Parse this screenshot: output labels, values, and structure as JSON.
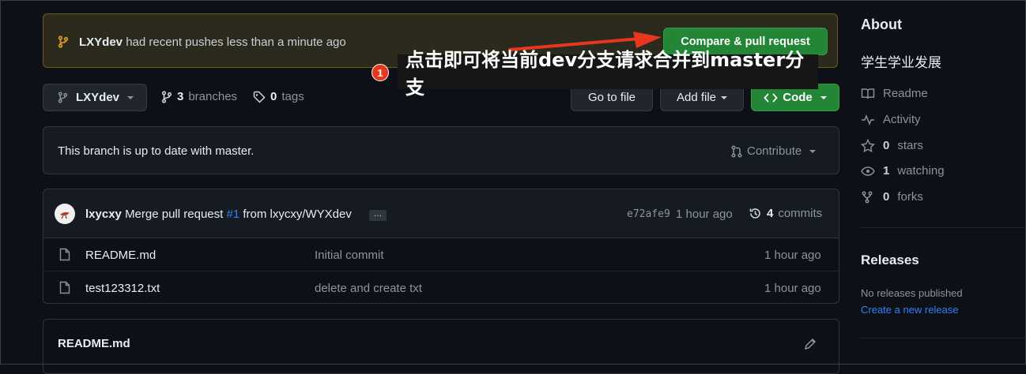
{
  "banner": {
    "branch": "LXYdev",
    "message": "had recent pushes less than a minute ago",
    "compare_button": "Compare & pull request"
  },
  "annotation": {
    "number": "1",
    "text": "点击即可将当前dev分支请求合并到master分支"
  },
  "toolbar": {
    "branch_name": "LXYdev",
    "branches_count": "3",
    "branches_label": "branches",
    "tags_count": "0",
    "tags_label": "tags",
    "go_to_file": "Go to file",
    "add_file": "Add file",
    "code": "Code"
  },
  "status": {
    "text": "This branch is up to date with master.",
    "contribute": "Contribute"
  },
  "latest_commit": {
    "author": "lxycxy",
    "message_prefix": "Merge pull request",
    "pr_link": "#1",
    "message_suffix": "from lxycxy/WYXdev",
    "ellipsis": "…",
    "sha": "e72afe9",
    "time": "1 hour ago",
    "commits_count": "4",
    "commits_label": "commits"
  },
  "files": [
    {
      "name": "README.md",
      "message": "Initial commit",
      "time": "1 hour ago"
    },
    {
      "name": "test123312.txt",
      "message": "delete and create txt",
      "time": "1 hour ago"
    }
  ],
  "readme": {
    "title": "README.md"
  },
  "sidebar": {
    "about_title": "About",
    "description": "学生学业发展",
    "items": [
      {
        "icon": "book-icon",
        "label": "Readme"
      },
      {
        "icon": "pulse-icon",
        "label": "Activity"
      },
      {
        "icon": "star-icon",
        "count": "0",
        "label": "stars"
      },
      {
        "icon": "eye-icon",
        "count": "1",
        "label": "watching"
      },
      {
        "icon": "fork-icon",
        "count": "0",
        "label": "forks"
      }
    ],
    "releases_title": "Releases",
    "no_releases": "No releases published",
    "create_release": "Create a new release"
  },
  "colors": {
    "background": "#0d1117",
    "primary_button": "#238636",
    "link": "#2f81f7",
    "annotation_red": "#e8361f"
  }
}
